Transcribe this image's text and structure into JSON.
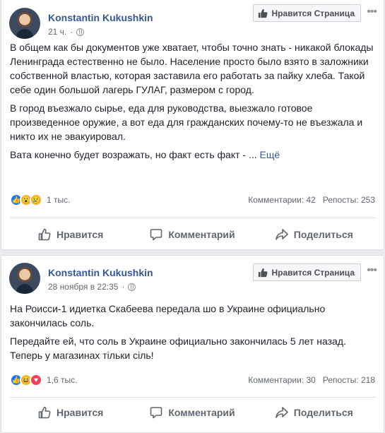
{
  "posts": [
    {
      "author": "Konstantin Kukushkin",
      "time": "21 ч.",
      "like_page_label": "Нравится Страница",
      "paragraphs": [
        "В общем как бы документов уже хватает, чтобы точно знать - никакой блокады Ленинграда естественно не было. Население просто было взято в заложники собственной властью, которая заставила его работать за пайку хлеба. Такой себе один большой лагерь ГУЛАГ, размером с город.",
        "В город въезжало сырье, еда для руководства, выезжало готовое произведенное оружие, а вот еда для гражданских почему-то не въезжала и никто их не эвакуировал."
      ],
      "last_line": "Вата конечно будет возражать, но факт есть факт - ...",
      "more_label": "Ещё",
      "reactions_count": "1 тыс.",
      "comments": "Комментарии: 42",
      "shares": "Репосты: 253"
    },
    {
      "author": "Konstantin Kukushkin",
      "time": "28 ноября в 22:35",
      "like_page_label": "Нравится Страница",
      "paragraphs": [
        "На Роисси-1 идиетка Скабеева передала шо в Украине официально закончилась соль.",
        "Передайте ей, что соль в Украине официально закончилась 5 лет назад. Теперь у магазинах тільки сіль!"
      ],
      "reactions_count": "1,6 тыс.",
      "comments": "Комментарии: 30",
      "shares": "Репосты: 218"
    }
  ],
  "actions": {
    "like": "Нравится",
    "comment": "Комментарий",
    "share": "Поделиться"
  },
  "dots": "•••",
  "icons": [
    "globe-icon",
    "thumb-up-icon",
    "comment-icon",
    "share-icon",
    "like-reaction-icon",
    "wow-reaction-icon",
    "sad-reaction-icon",
    "haha-reaction-icon",
    "love-reaction-icon"
  ],
  "colors": {
    "link": "#365899",
    "accent": "#1877f2",
    "text": "#1d2129",
    "muted": "#606770"
  }
}
